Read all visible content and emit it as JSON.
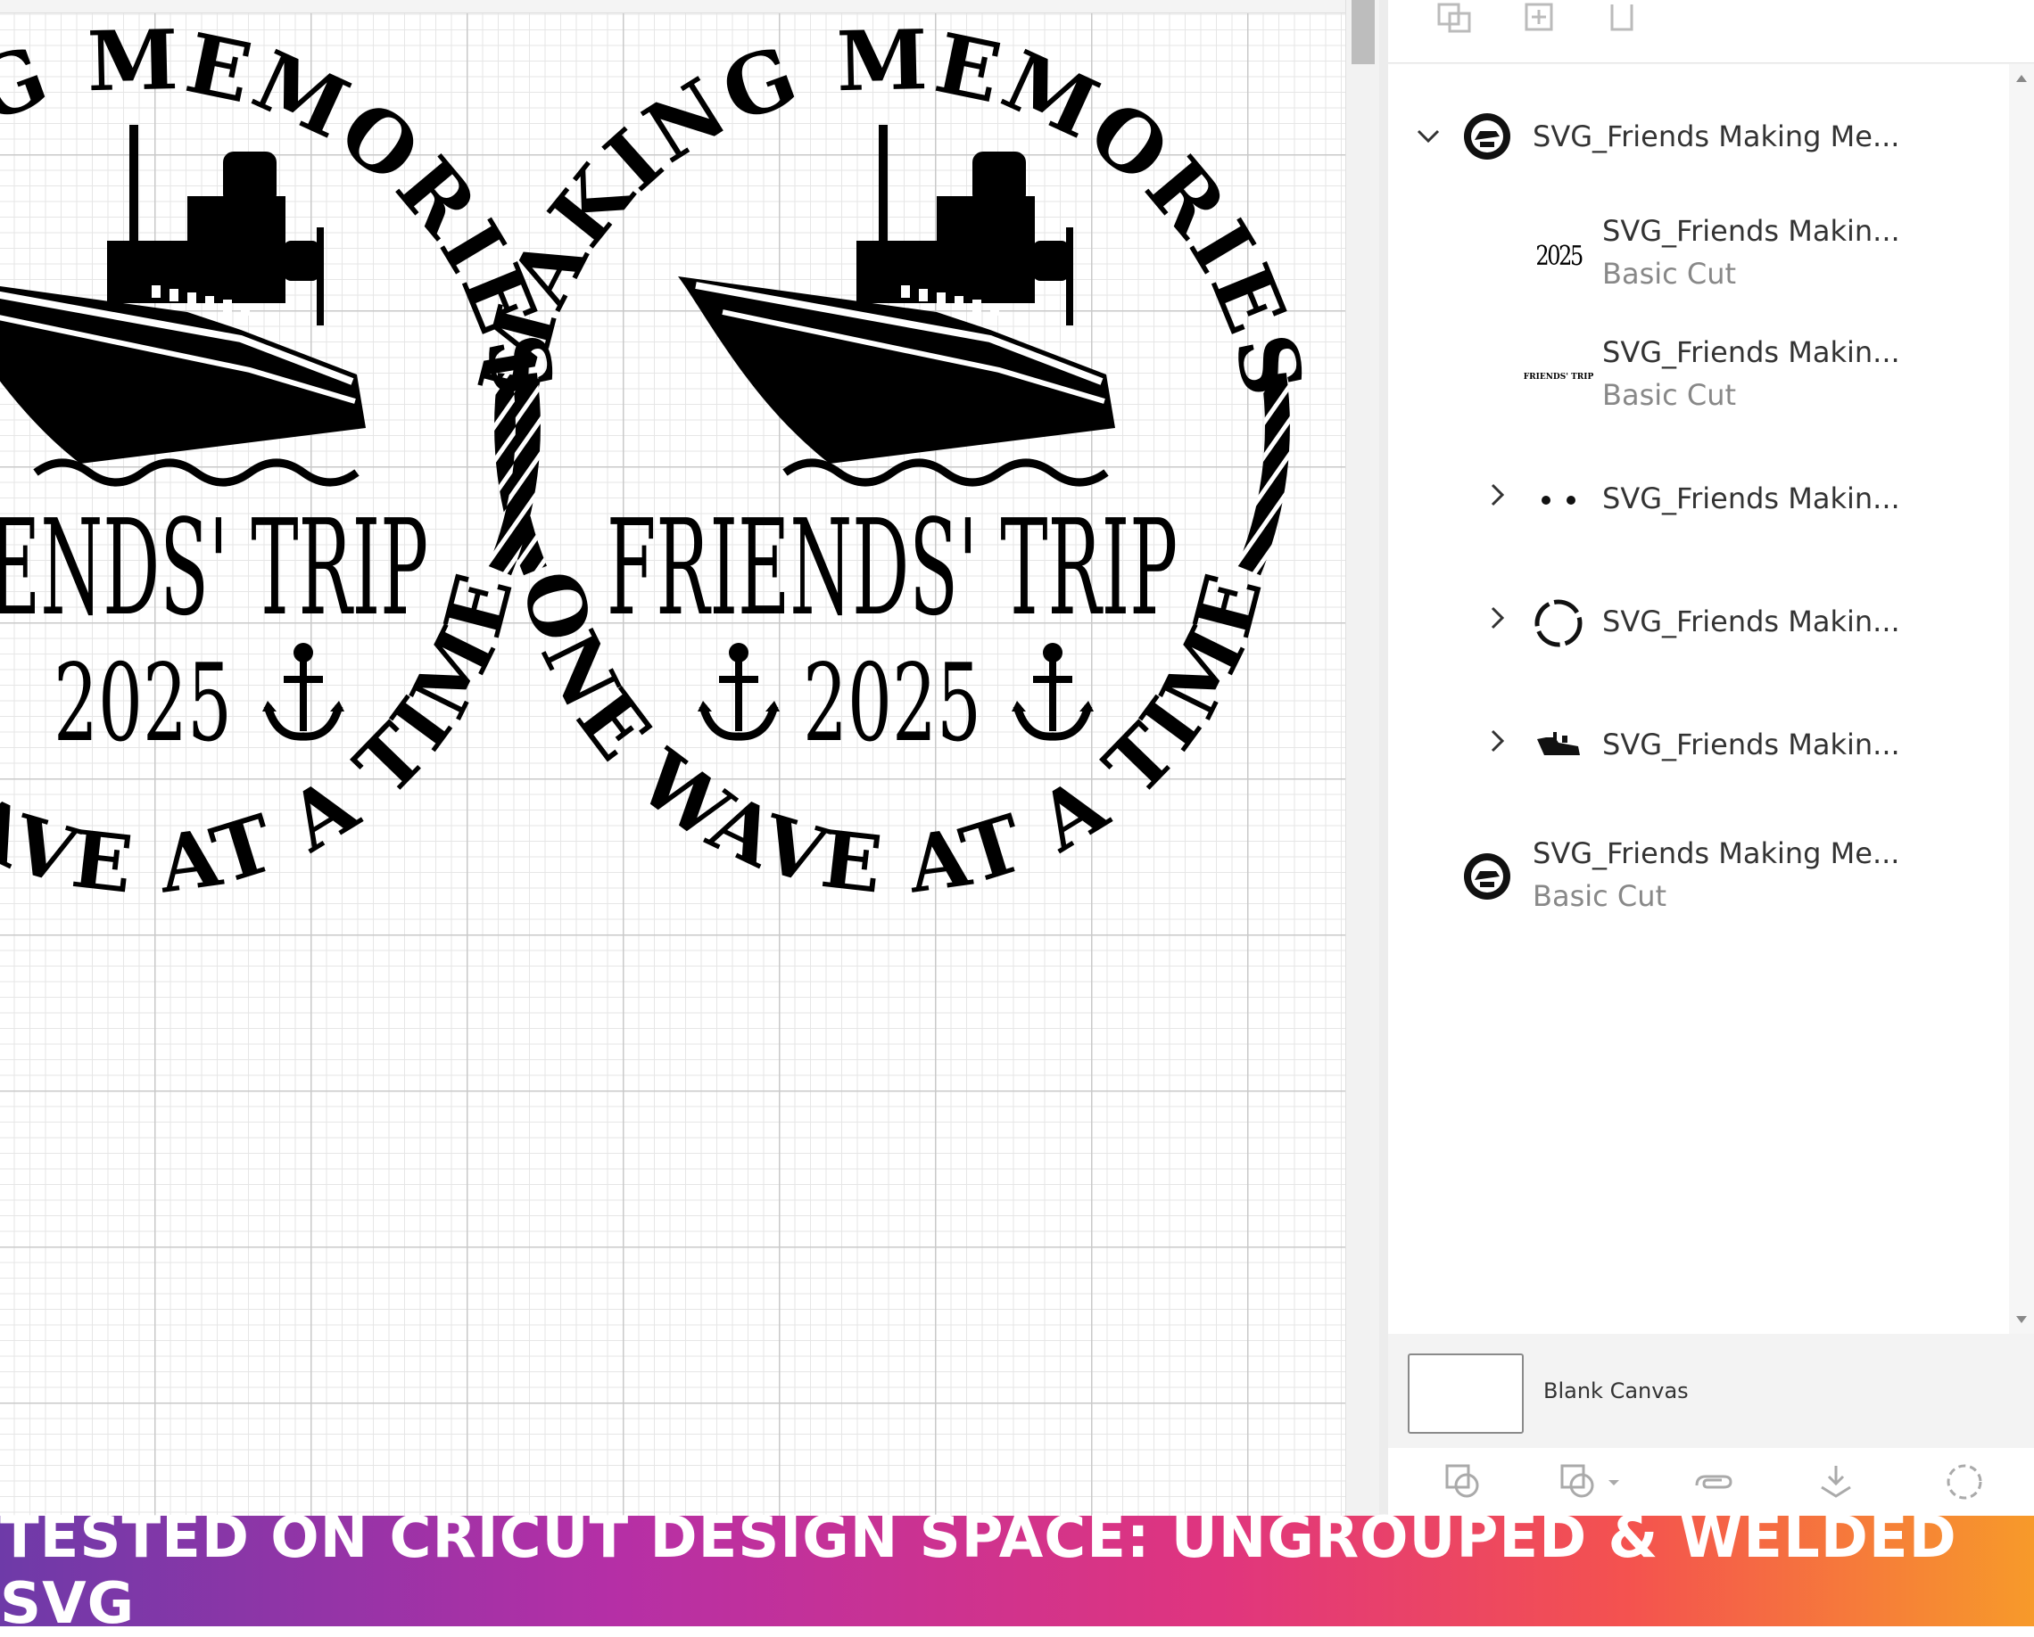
{
  "design": {
    "arc_top": "MAKING MEMORIES",
    "title": "FRIENDS' TRIP",
    "year": "2025",
    "arc_bottom": "ONE WAVE AT A TIME"
  },
  "layers": {
    "group_name": "SVG_Friends Making Me...",
    "items": [
      {
        "name": "SVG_Friends Makin...",
        "sub": "Basic Cut",
        "thumb_text": "2025",
        "thumb_icon": "year-2025-icon"
      },
      {
        "name": "SVG_Friends Makin...",
        "sub": "Basic Cut",
        "thumb_text": "FRIENDS' TRIP",
        "thumb_icon": "friends-trip-text-icon"
      },
      {
        "name": "SVG_Friends Makin...",
        "thumb_icon": "anchors-icon"
      },
      {
        "name": "SVG_Friends Makin...",
        "thumb_icon": "rope-circle-icon"
      },
      {
        "name": "SVG_Friends Makin...",
        "thumb_icon": "ship-icon"
      }
    ],
    "bottom_item": {
      "name": "SVG_Friends Making Me...",
      "sub": "Basic Cut"
    }
  },
  "blank_canvas": {
    "label": "Blank Canvas"
  },
  "banner": {
    "text": "TESTED ON CRICUT DESIGN SPACE: UNGROUPED & WELDED SVG"
  }
}
